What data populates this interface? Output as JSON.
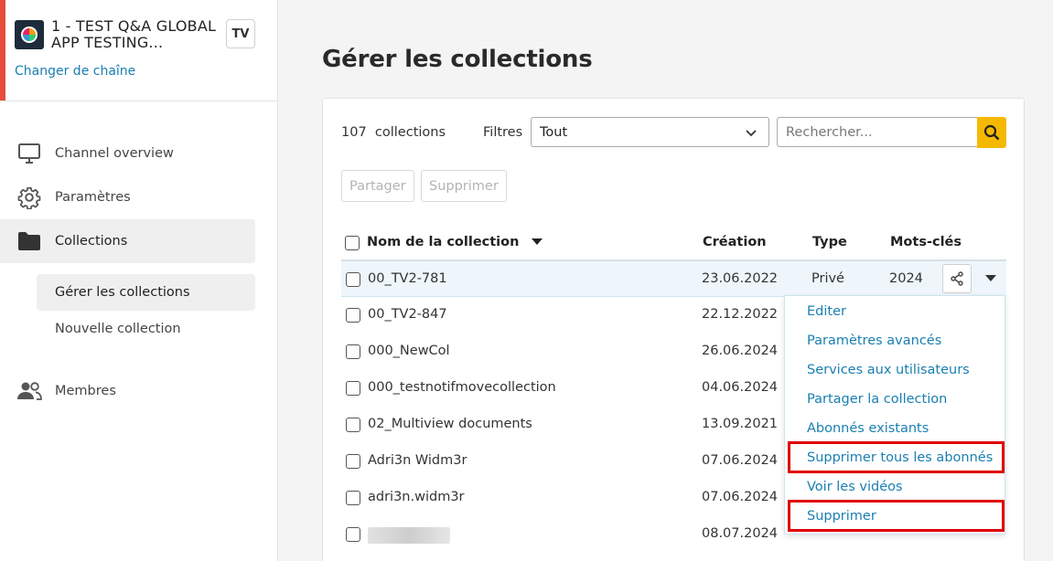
{
  "channel": {
    "name": "1 - TEST Q&A GLOBAL APP TESTING...",
    "badge": "TV",
    "change_link": "Changer de chaîne"
  },
  "nav": {
    "items": [
      {
        "label": "Channel overview",
        "icon": "monitor-icon"
      },
      {
        "label": "Paramètres",
        "icon": "gear-icon"
      },
      {
        "label": "Collections",
        "icon": "folder-icon",
        "active": true
      },
      {
        "label": "Membres",
        "icon": "users-icon"
      }
    ],
    "sub_items": [
      {
        "label": "Gérer les collections",
        "active": true
      },
      {
        "label": "Nouvelle collection"
      }
    ]
  },
  "page": {
    "title": "Gérer les collections"
  },
  "toolbar": {
    "count": "107  collections",
    "filters_label": "Filtres",
    "filter_value": "Tout",
    "search_placeholder": "Rechercher...",
    "share_label": "Partager",
    "delete_label": "Supprimer"
  },
  "table": {
    "columns": [
      "Nom de la collection",
      "Création",
      "Type",
      "Mots-clés"
    ],
    "rows": [
      {
        "name": "00_TV2-781",
        "date": "23.06.2022",
        "type": "Privé",
        "keywords": "2024"
      },
      {
        "name": "00_TV2-847",
        "date": "22.12.2022",
        "type": "",
        "keywords": ""
      },
      {
        "name": "000_NewCol",
        "date": "26.06.2024",
        "type": "",
        "keywords": ""
      },
      {
        "name": "000_testnotifmovecollection",
        "date": "04.06.2024",
        "type": "",
        "keywords": ""
      },
      {
        "name": "02_Multiview documents",
        "date": "13.09.2021",
        "type": "",
        "keywords": ""
      },
      {
        "name": "Adri3n Widm3r",
        "date": "07.06.2024",
        "type": "",
        "keywords": ""
      },
      {
        "name": "adri3n.widm3r",
        "date": "07.06.2024",
        "type": "",
        "keywords": ""
      },
      {
        "name": "",
        "date": "08.07.2024",
        "type": "",
        "keywords": ""
      }
    ]
  },
  "menu": {
    "items": [
      {
        "label": "Editer"
      },
      {
        "label": "Paramètres avancés"
      },
      {
        "label": "Services aux utilisateurs"
      },
      {
        "label": "Partager la collection"
      },
      {
        "label": "Abonnés existants"
      },
      {
        "label": "Supprimer tous les abonnés",
        "highlighted": true
      },
      {
        "label": "Voir les vidéos"
      },
      {
        "label": "Supprimer",
        "highlighted": true
      }
    ],
    "highlight_color": "#e00000",
    "link_color": "#1a7fb0"
  },
  "colors": {
    "accent_strip": "#e74c3c",
    "search_button": "#f5b800"
  }
}
